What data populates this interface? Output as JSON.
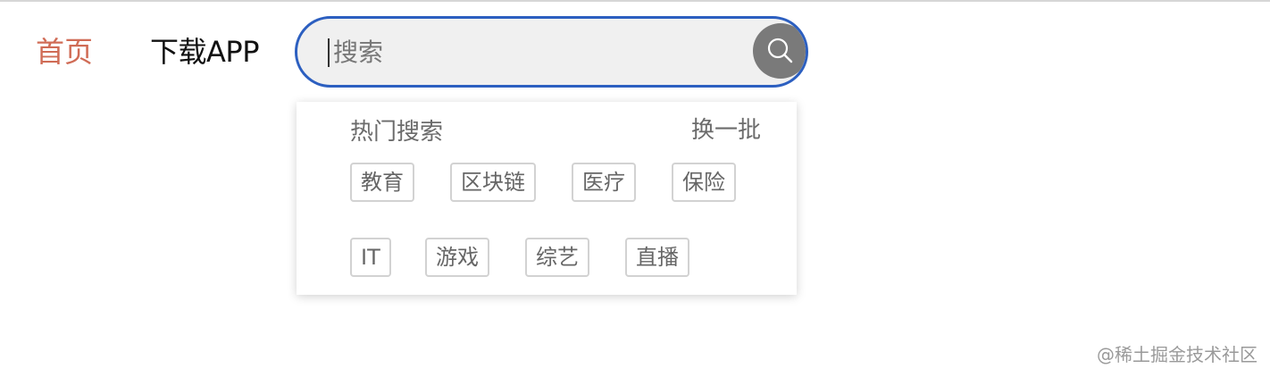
{
  "nav": {
    "home_label": "首页",
    "app_label": "下载APP"
  },
  "search": {
    "placeholder": "搜索",
    "value": ""
  },
  "hot_search": {
    "title": "热门搜索",
    "refresh_label": "换一批",
    "tags": [
      "教育",
      "区块链",
      "医疗",
      "保险",
      "IT",
      "游戏",
      "综艺",
      "直播"
    ]
  },
  "watermark": "@稀土掘金技术社区",
  "colors": {
    "active_nav": "#d06c56",
    "search_border": "#2c5fc0",
    "search_bg": "#f0f0f0",
    "search_button": "#7a7a7a"
  }
}
